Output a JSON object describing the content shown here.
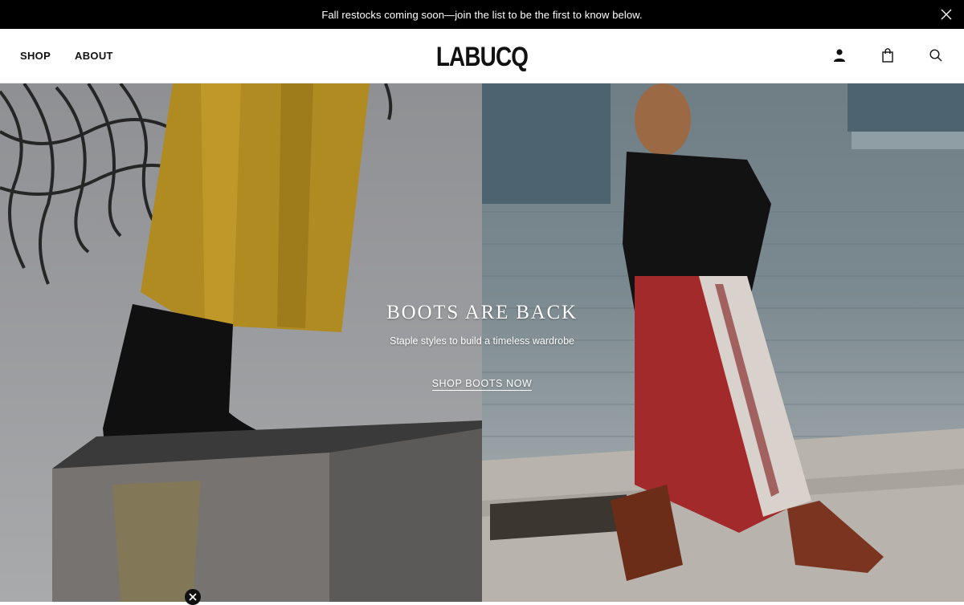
{
  "announcement": {
    "text": "Fall restocks coming soon—join the list to be the first to know below."
  },
  "header": {
    "nav": [
      {
        "label": "SHOP"
      },
      {
        "label": "ABOUT"
      }
    ],
    "logo": "LABUCQ",
    "icons": [
      "account-icon",
      "bag-icon",
      "search-icon"
    ]
  },
  "hero": {
    "title": "BOOTS ARE BACK",
    "subtitle": "Staple styles to build a timeless wardrobe",
    "cta": "SHOP BOOTS NOW"
  },
  "colors": {
    "announcement_bg": "#000000",
    "text_primary": "#111111",
    "hero_text": "#ffffff"
  }
}
